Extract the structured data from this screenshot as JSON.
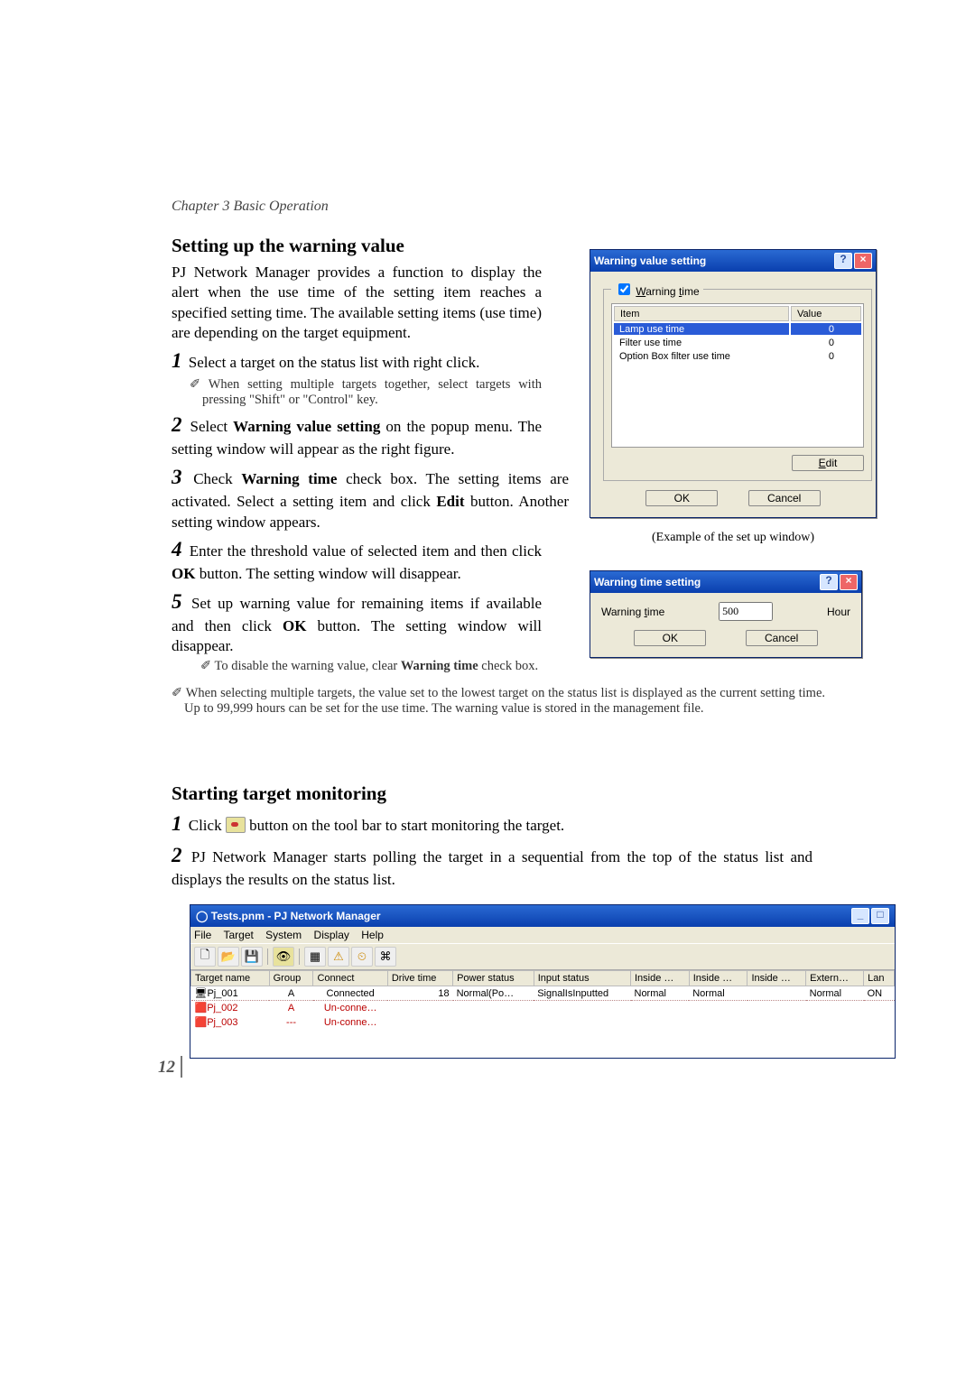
{
  "chapter": "Chapter 3 Basic Operation",
  "section1": {
    "heading": "Setting up the warning value",
    "intro": "PJ Network Manager provides a function to display the alert when the use time of the setting item reaches a specified setting time. The available setting items (use time) are depending on the target equipment.",
    "step1": "Select a target on the status list with right click.",
    "note1": "When setting multiple targets together, select targets with pressing \"Shift\" or \"Control\" key.",
    "step2_a": "Select ",
    "step2_bold": "Warning value setting",
    "step2_b": " on the popup menu. The setting window will appear as the right figure.",
    "step3_a": "Check ",
    "step3_bold1": "Warning time",
    "step3_mid": " check box. The setting items are activated. Select a setting item and click ",
    "step3_bold2": "Edit",
    "step3_b": " button. Another setting window appears.",
    "step4_a": "Enter the threshold value of selected item and then click ",
    "step4_bold": "OK",
    "step4_b": " button. The setting window will disappear.",
    "step5_a": "Set up warning value for remaining items if available and then click ",
    "step5_bold": "OK",
    "step5_b": " button. The setting window will disappear.",
    "note2_a": "To disable the warning value, clear ",
    "note2_bold": "Warning time",
    "note2_b": " check box.",
    "widenote": "When selecting multiple targets, the value set to the lowest target on the status list is displayed as the current setting time. Up to 99,999 hours can be set for the use time. The warning value is stored in the management file."
  },
  "dialog1": {
    "title": "Warning value setting",
    "checkbox": "Warning time",
    "col_item": "Item",
    "col_value": "Value",
    "rows": [
      {
        "item": "Lamp use time",
        "value": "0"
      },
      {
        "item": "Filter use time",
        "value": "0"
      },
      {
        "item": "Option Box filter use time",
        "value": "0"
      }
    ],
    "edit": "Edit",
    "ok": "OK",
    "cancel": "Cancel"
  },
  "caption1": "(Example of the set up window)",
  "dialog2": {
    "title": "Warning time setting",
    "label": "Warning time",
    "value": "500",
    "unit": "Hour",
    "ok": "OK",
    "cancel": "Cancel"
  },
  "section2": {
    "heading": "Starting target monitoring",
    "step1_a": "Click ",
    "step1_b": " button on the tool bar to start monitoring the target.",
    "step2": "PJ Network Manager starts polling the target in a sequential from the top of the status list and displays the results on the status list."
  },
  "appwindow": {
    "title": "Tests.pnm - PJ Network Manager",
    "menus": [
      "File",
      "Target",
      "System",
      "Display",
      "Help"
    ],
    "columns": [
      "Target name",
      "Group",
      "Connect",
      "Drive time",
      "Power status",
      "Input status",
      "Inside …",
      "Inside …",
      "Inside …",
      "Extern…",
      "Lan"
    ],
    "rows": [
      {
        "icon": "proj",
        "name": "Pj_001",
        "group": "A",
        "connect": "Connected",
        "drive": "18",
        "power": "Normal(Po…",
        "input": "SignalIsInputted",
        "i1": "Normal",
        "i2": "Normal",
        "i3": "",
        "ext": "Normal",
        "lan": "ON"
      },
      {
        "icon": "err",
        "name": "Pj_002",
        "group": "A",
        "connect": "Un-conne…"
      },
      {
        "icon": "err",
        "name": "Pj_003",
        "group": "---",
        "connect": "Un-conne…"
      }
    ]
  },
  "page_number": "12"
}
